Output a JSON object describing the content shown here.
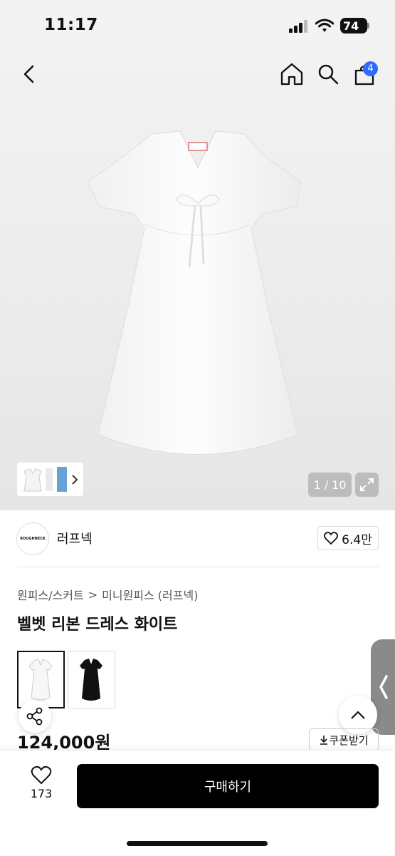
{
  "status": {
    "time": "11:17",
    "battery": "74"
  },
  "header": {
    "cart_count": "4"
  },
  "gallery": {
    "counter": "1 / 10",
    "total_images": 10,
    "current_image": 1
  },
  "brand": {
    "logo_text": "ROUGHNECK",
    "name": "러프넥",
    "likes": "6.4만"
  },
  "breadcrumb": {
    "category": "원피스/스커트",
    "separator": ">",
    "subcategory": "미니원피스 (러프넥)"
  },
  "product": {
    "title": "벨벳 리본 드레스 화이트",
    "price": "124,000원",
    "coupon_label": "쿠폰받기"
  },
  "options": [
    {
      "color": "white",
      "selected": true
    },
    {
      "color": "black",
      "selected": false
    }
  ],
  "bottom": {
    "wish_count": "173",
    "buy_label": "구매하기"
  },
  "colors": {
    "accent": "#2f6bff",
    "buy_button": "#000000",
    "hero_bg": "#efefef"
  }
}
